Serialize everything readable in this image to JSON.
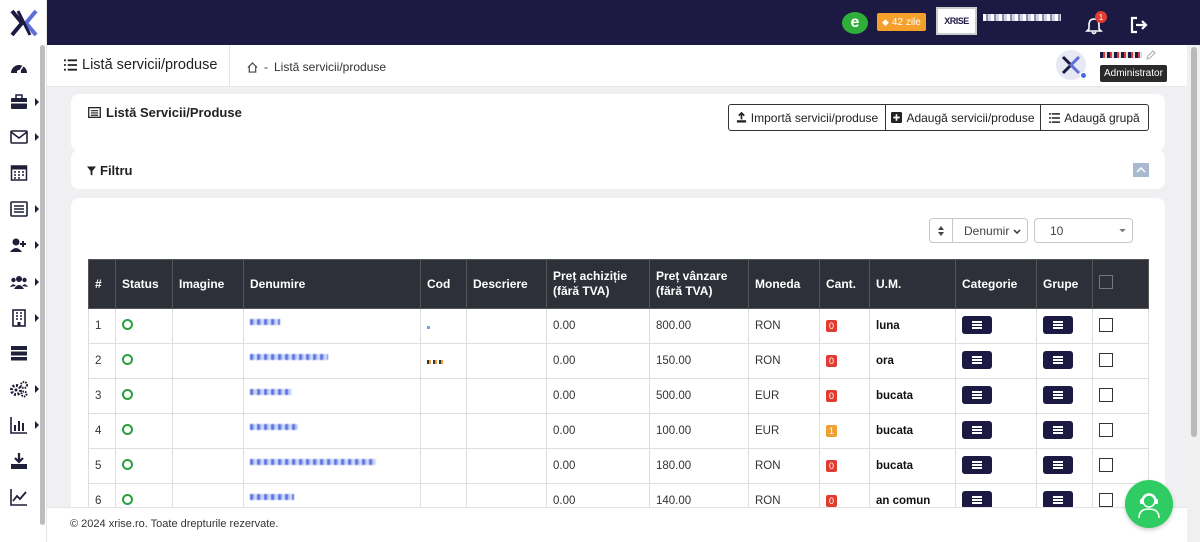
{
  "topbar": {
    "trial_badge": "42 zile",
    "brand_logo_text": "XRISE",
    "notification_count": "1"
  },
  "breadcrumb": {
    "page_title": "Listă servicii/produse",
    "crumb": "Listă servicii/produse"
  },
  "user": {
    "role_tooltip": "Administrator"
  },
  "card": {
    "title": "Listă Servicii/Produse",
    "buttons": {
      "import": "Importă servicii/produse",
      "add": "Adaugă servicii/produse",
      "add_group": "Adaugă grupă"
    },
    "filter_label": "Filtru"
  },
  "table_controls": {
    "sort_value": "Denumir",
    "page_size_value": "10"
  },
  "table": {
    "headers": {
      "num": "#",
      "status": "Status",
      "image": "Imagine",
      "name": "Denumire",
      "code": "Cod",
      "desc": "Descriere",
      "buy_price_1": "Preț achiziție",
      "buy_price_2": "(fără TVA)",
      "sell_price_1": "Preț vânzare",
      "sell_price_2": "(fără TVA)",
      "currency": "Moneda",
      "qty": "Cant.",
      "um": "U.M.",
      "category": "Categorie",
      "groups": "Grupe"
    },
    "rows": [
      {
        "num": "1",
        "buy": "0.00",
        "sell": "800.00",
        "currency": "RON",
        "qty": "0",
        "um": "luna"
      },
      {
        "num": "2",
        "buy": "0.00",
        "sell": "150.00",
        "currency": "RON",
        "qty": "0",
        "um": "ora"
      },
      {
        "num": "3",
        "buy": "0.00",
        "sell": "500.00",
        "currency": "EUR",
        "qty": "0",
        "um": "bucata"
      },
      {
        "num": "4",
        "buy": "0.00",
        "sell": "100.00",
        "currency": "EUR",
        "qty": "1",
        "um": "bucata"
      },
      {
        "num": "5",
        "buy": "0.00",
        "sell": "180.00",
        "currency": "RON",
        "qty": "0",
        "um": "bucata"
      },
      {
        "num": "6",
        "buy": "0.00",
        "sell": "140.00",
        "currency": "RON",
        "qty": "0",
        "um": "an comun"
      }
    ]
  },
  "footer": {
    "text": "© 2024 xrise.ro. Toate drepturile rezervate."
  },
  "colors": {
    "navy": "#1c1943",
    "accent_green": "#2e9e3e",
    "badge_red": "#e23c32",
    "badge_orange": "#f0a032",
    "trial_orange": "#f5a02a"
  }
}
